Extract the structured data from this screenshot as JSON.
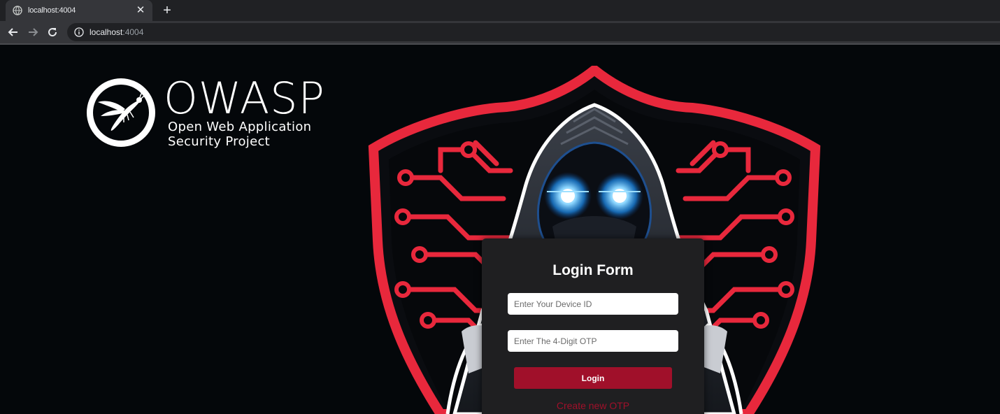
{
  "browser": {
    "tab": {
      "title": "localhost:4004",
      "favicon": "globe-icon",
      "close": "✕"
    },
    "new_tab": "+",
    "nav": {
      "back": "arrow-left-icon",
      "forward": "arrow-right-icon",
      "reload": "reload-icon"
    },
    "omnibox": {
      "host": "localhost",
      "port": ":4004",
      "icon": "info-icon"
    }
  },
  "logo": {
    "word": "OWASP",
    "line1": "Open Web Application",
    "line2": "Security Project"
  },
  "login": {
    "title": "Login Form",
    "device_placeholder": "Enter Your Device ID",
    "otp_placeholder": "Enter The 4-Digit OTP",
    "button": "Login",
    "link": "Create new OTP"
  },
  "colors": {
    "page_bg": "#04070a",
    "accent_red": "#e8283c",
    "button_red": "#a0102a",
    "card_bg": "#1f1f21",
    "eye_glow": "#2aa8ff"
  }
}
